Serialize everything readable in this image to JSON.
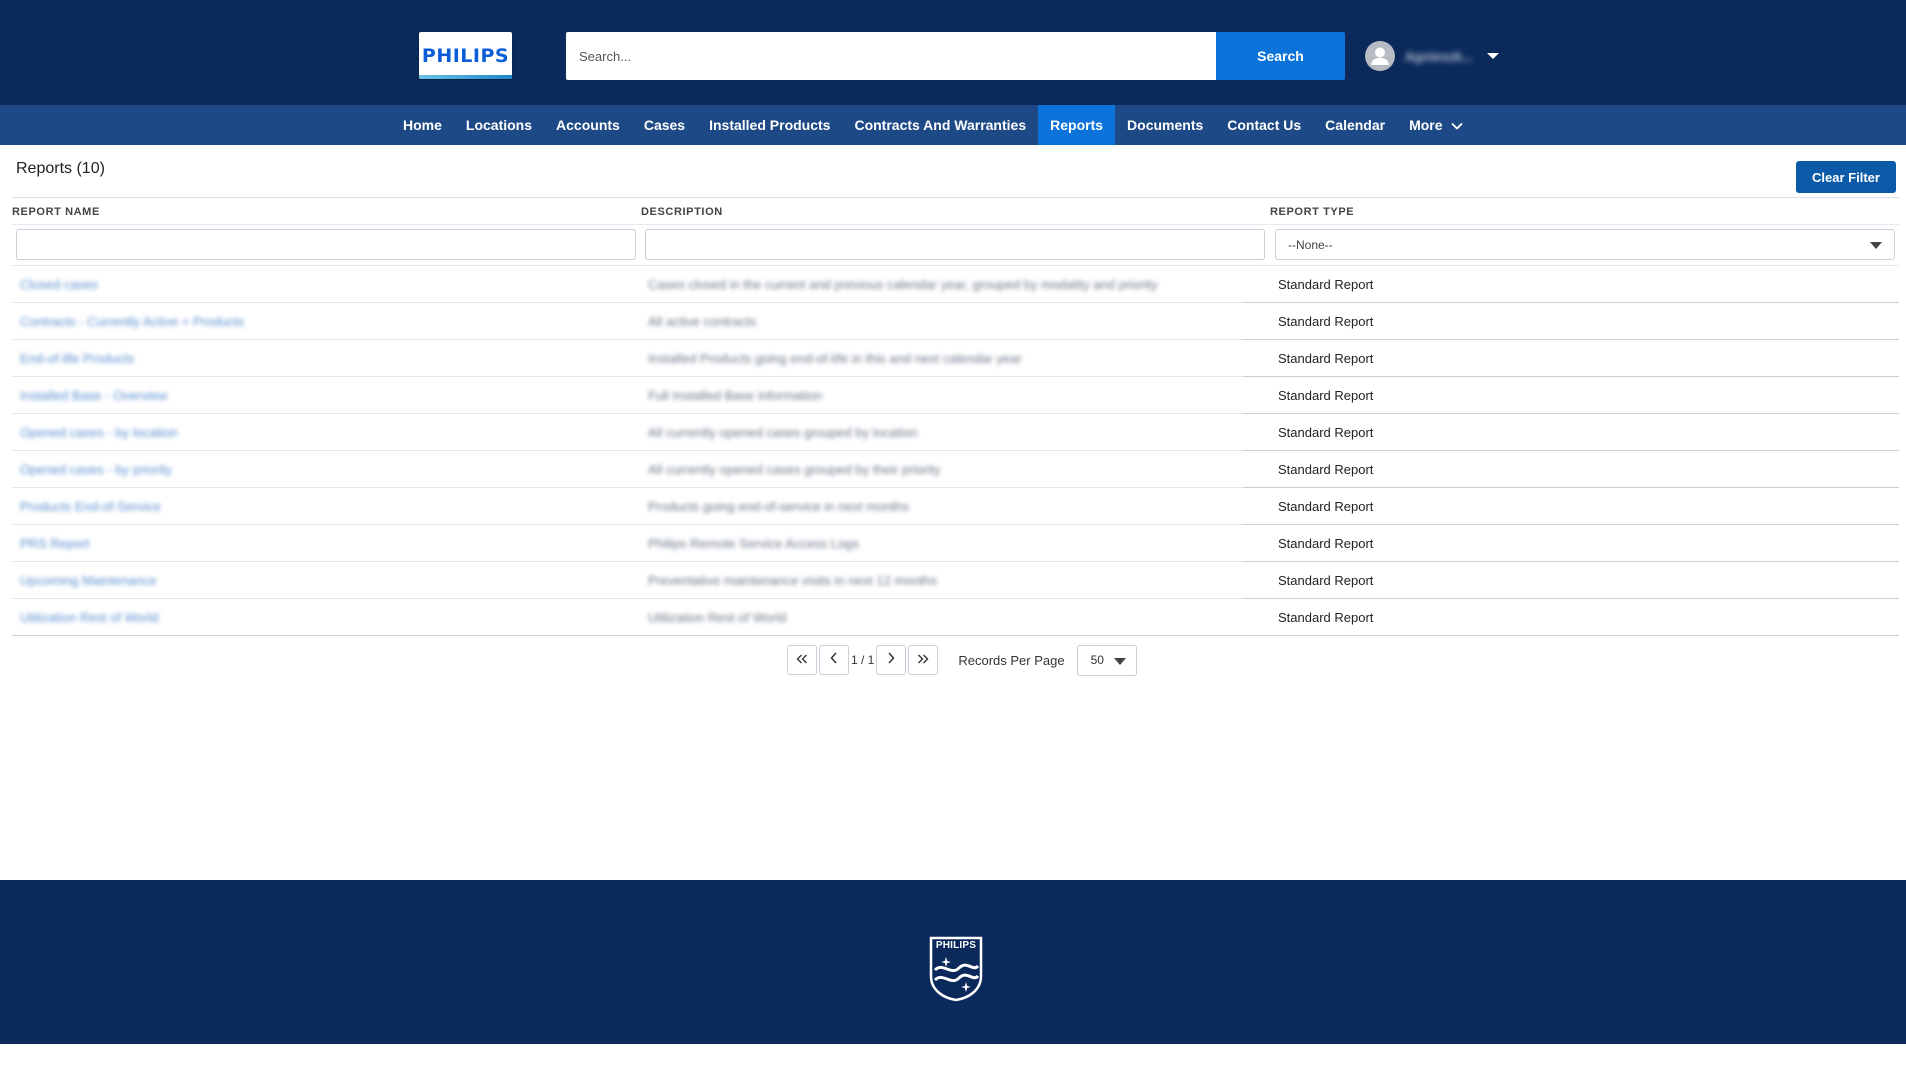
{
  "header": {
    "logo_text": "PHILIPS",
    "search_placeholder": "Search...",
    "search_button": "Search",
    "user_name": "Agnieszk...",
    "user_icon": "user-avatar-icon",
    "user_caret_icon": "caret-down-icon"
  },
  "nav": {
    "items": [
      {
        "label": "Home",
        "active": false
      },
      {
        "label": "Locations",
        "active": false
      },
      {
        "label": "Accounts",
        "active": false
      },
      {
        "label": "Cases",
        "active": false
      },
      {
        "label": "Installed Products",
        "active": false
      },
      {
        "label": "Contracts And Warranties",
        "active": false
      },
      {
        "label": "Reports",
        "active": true
      },
      {
        "label": "Documents",
        "active": false
      },
      {
        "label": "Contact Us",
        "active": false
      },
      {
        "label": "Calendar",
        "active": false
      },
      {
        "label": "More",
        "active": false
      }
    ],
    "more_icon": "chevron-down-icon"
  },
  "main": {
    "title": "Reports (10)",
    "clear_filter": "Clear Filter",
    "columns": [
      "REPORT NAME",
      "DESCRIPTION",
      "REPORT TYPE"
    ],
    "type_filter_value": "--None--",
    "rows": [
      {
        "name": "Closed cases",
        "description": "Cases closed in the current and previous calendar year, grouped by modality and priority",
        "type": "Standard Report"
      },
      {
        "name": "Contracts - Currently Active + Products",
        "description": "All active contracts",
        "type": "Standard Report"
      },
      {
        "name": "End-of-life Products",
        "description": "Installed Products going end-of-life in this and next calendar year",
        "type": "Standard Report"
      },
      {
        "name": "Installed Base - Overview",
        "description": "Full Installed Base information",
        "type": "Standard Report"
      },
      {
        "name": "Opened cases - by location",
        "description": "All currently opened cases grouped by location",
        "type": "Standard Report"
      },
      {
        "name": "Opened cases - by priority",
        "description": "All currently opened cases grouped by their priority",
        "type": "Standard Report"
      },
      {
        "name": "Products End-of-Service",
        "description": "Products going end-of-service in next months",
        "type": "Standard Report"
      },
      {
        "name": "PRS Report",
        "description": "Philips Remote Service Access Logs",
        "type": "Standard Report"
      },
      {
        "name": "Upcoming Maintenance",
        "description": "Preventative maintenance visits in next 12 months",
        "type": "Standard Report"
      },
      {
        "name": "Utilization Rest of World",
        "description": "Utilization Rest of World",
        "type": "Standard Report"
      }
    ]
  },
  "pagination": {
    "first_icon": "double-chevron-left-icon",
    "prev_icon": "chevron-left-icon",
    "page_indicator": "1 / 1",
    "next_icon": "chevron-right-icon",
    "last_icon": "double-chevron-right-icon",
    "records_per_page_label": "Records Per Page",
    "records_per_page_value": "50"
  },
  "footer": {
    "brand_text": "PHILIPS",
    "shield_icon": "philips-shield-icon"
  },
  "colors": {
    "header_bg": "#0b2a5b",
    "nav_bg": "#1d4a86",
    "accent": "#0b73da",
    "clear_filter_bg": "#0b5aa8",
    "link": "#5a8fd0"
  }
}
